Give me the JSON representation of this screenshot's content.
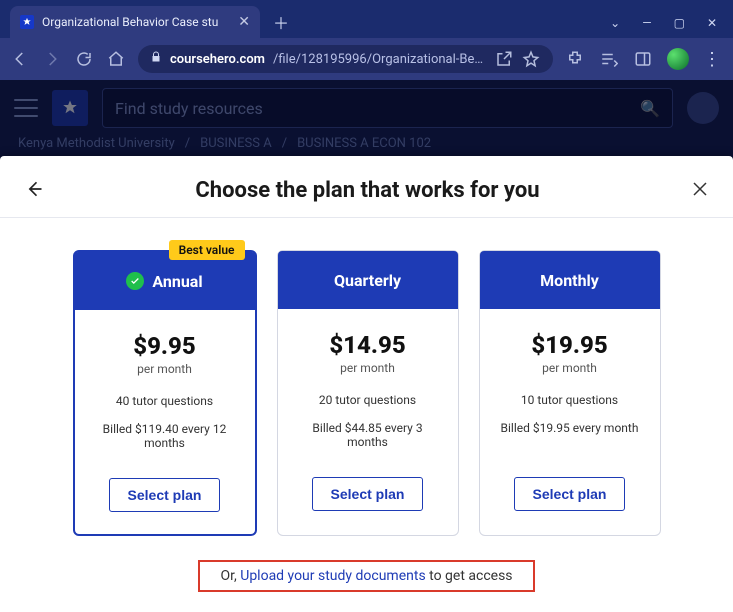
{
  "browser": {
    "tab_title": "Organizational Behavior Case stu",
    "url_domain": "coursehero.com",
    "url_path": "/file/128195996/Organizational-Beh..."
  },
  "page": {
    "search_placeholder": "Find study resources",
    "breadcrumbs": [
      "Kenya Methodist University",
      "BUSINESS A",
      "BUSINESS A ECON 102"
    ]
  },
  "modal": {
    "title": "Choose the plan that works for you",
    "best_value_label": "Best value",
    "select_label": "Select plan",
    "or_prefix": "Or, ",
    "or_link": "Upload your study documents",
    "or_suffix": " to get access",
    "plans": [
      {
        "name": "Annual",
        "price": "$9.95",
        "per": "per month",
        "tutor": "40 tutor questions",
        "billed": "Billed $119.40 every 12 months",
        "featured": true
      },
      {
        "name": "Quarterly",
        "price": "$14.95",
        "per": "per month",
        "tutor": "20 tutor questions",
        "billed": "Billed $44.85 every 3 months",
        "featured": false
      },
      {
        "name": "Monthly",
        "price": "$19.95",
        "per": "per month",
        "tutor": "10 tutor questions",
        "billed": "Billed $19.95 every month",
        "featured": false
      }
    ]
  }
}
